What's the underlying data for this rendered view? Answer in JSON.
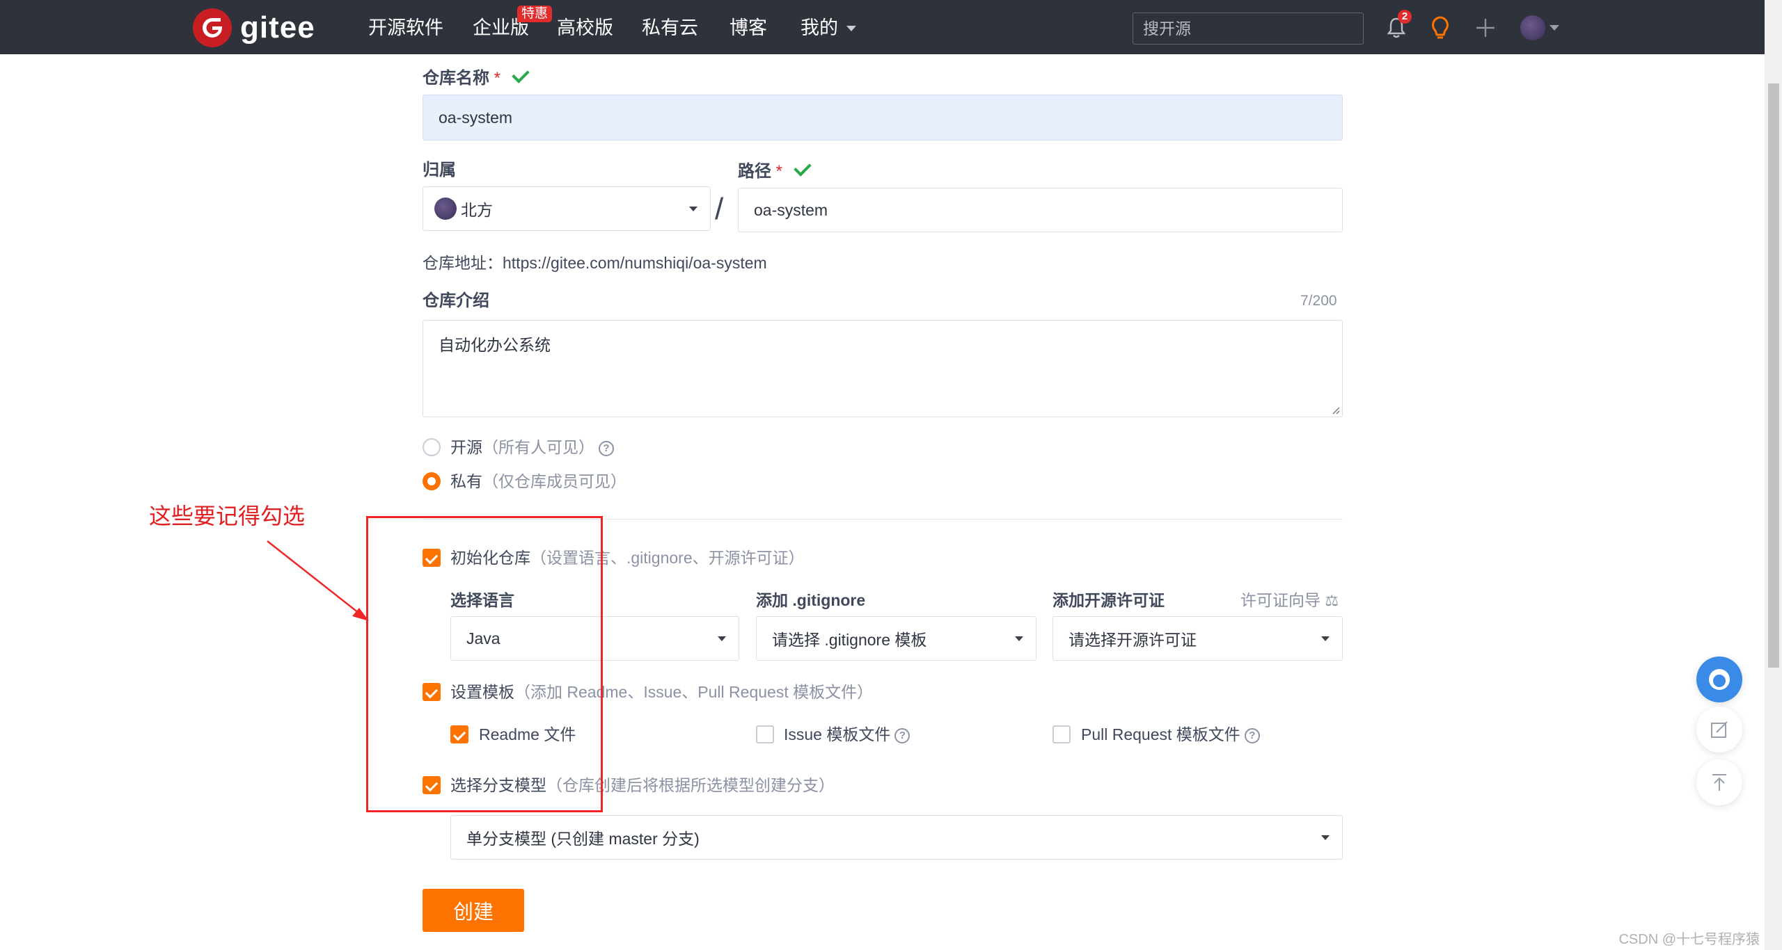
{
  "nav": {
    "logo_text": "gitee",
    "items": [
      {
        "label": "开源软件"
      },
      {
        "label": "企业版"
      },
      {
        "label": "高校版"
      },
      {
        "label": "私有云"
      },
      {
        "label": "博客"
      },
      {
        "label": "我的"
      }
    ],
    "enterprise_badge": "特惠",
    "search_placeholder": "搜开源",
    "notification_count": "2"
  },
  "form": {
    "repo_name": {
      "label": "仓库名称",
      "required": "*",
      "value": "oa-system"
    },
    "owner": {
      "label": "归属",
      "value": "北方"
    },
    "path": {
      "label": "路径",
      "required": "*",
      "value": "oa-system"
    },
    "separator": "/",
    "repo_address": "仓库地址：https://gitee.com/numshiqi/oa-system",
    "description": {
      "label": "仓库介绍",
      "counter": "7/200",
      "value": "自动化办公系统"
    },
    "visibility": {
      "public": {
        "label": "开源",
        "hint": "（所有人可见）",
        "selected": false
      },
      "private": {
        "label": "私有",
        "hint": "（仅仓库成员可见）",
        "selected": true
      }
    },
    "init_repo": {
      "label": "初始化仓库",
      "hint": "（设置语言、.gitignore、开源许可证）",
      "checked": true
    },
    "language": {
      "label": "选择语言",
      "value": "Java"
    },
    "gitignore": {
      "label": "添加 .gitignore",
      "value": "请选择 .gitignore 模板"
    },
    "license": {
      "label": "添加开源许可证",
      "guide": "许可证向导",
      "value": "请选择开源许可证"
    },
    "template": {
      "label": "设置模板",
      "hint": "（添加 Readme、Issue、Pull Request 模板文件）",
      "checked": true
    },
    "readme": {
      "label": "Readme 文件",
      "checked": true
    },
    "issue_tpl": {
      "label": "Issue 模板文件",
      "checked": false
    },
    "pr_tpl": {
      "label": "Pull Request 模板文件",
      "checked": false
    },
    "branch_model": {
      "label": "选择分支模型",
      "hint": "（仓库创建后将根据所选模型创建分支）",
      "checked": true,
      "value": "单分支模型 (只创建 master 分支)"
    },
    "create_button": "创建"
  },
  "annotation": {
    "text": "这些要记得勾选"
  },
  "watermark": "CSDN @十七号程序猿",
  "colors": {
    "nav_bg": "#2e323b",
    "accent": "#fe7300",
    "brand": "#c71d23",
    "annotation": "#f02525"
  }
}
